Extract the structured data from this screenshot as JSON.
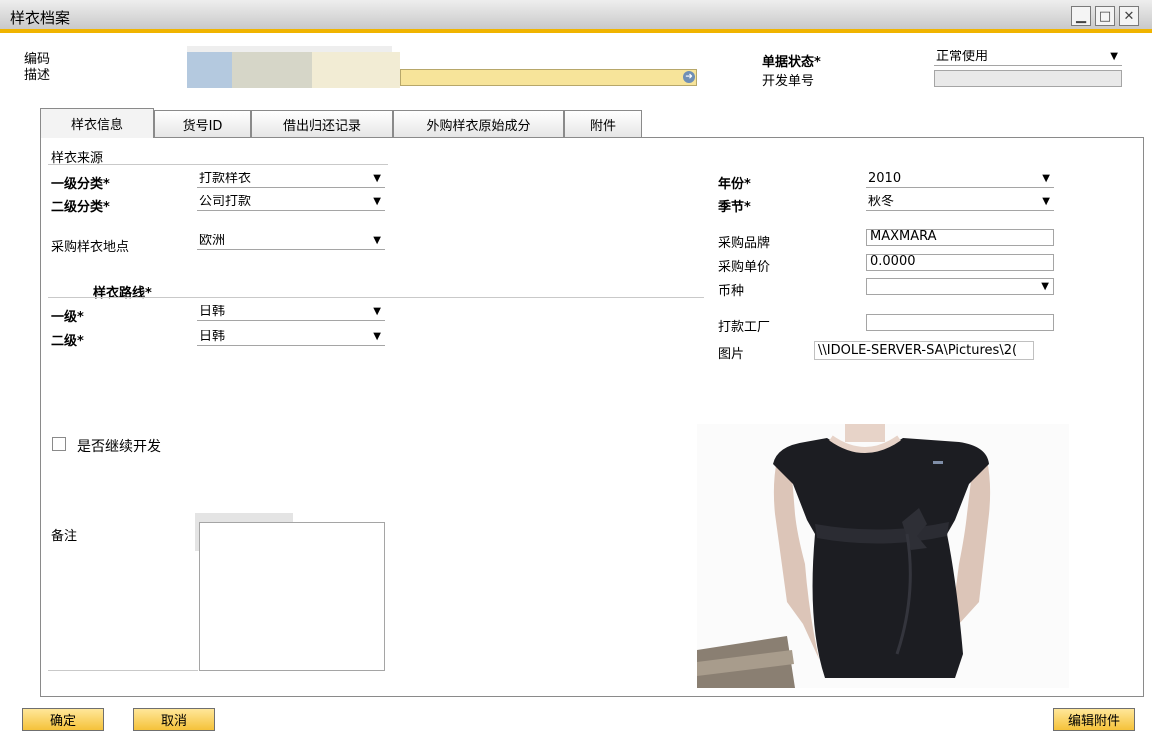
{
  "window": {
    "title": "样衣档案",
    "controls": [
      "minimize-icon",
      "maximize-icon",
      "close-icon"
    ]
  },
  "header": {
    "code_label": "编码",
    "desc_label": "描述",
    "doc_status_label": "单据状态*",
    "doc_status_value": "正常使用",
    "dev_no_label": "开发单号"
  },
  "tabs": [
    {
      "label": "样衣信息",
      "active": true
    },
    {
      "label": "货号ID"
    },
    {
      "label": "借出归还记录"
    },
    {
      "label": "外购样衣原始成分"
    },
    {
      "label": "附件"
    }
  ],
  "form": {
    "source_label": "样衣来源",
    "cat1_label": "一级分类*",
    "cat1_value": "打款样衣",
    "cat2_label": "二级分类*",
    "cat2_value": "公司打款",
    "purchase_place_label": "采购样衣地点",
    "purchase_place_value": "欧洲",
    "route_label": "样衣路线*",
    "route1_label": "一级*",
    "route1_value": "日韩",
    "route2_label": "二级*",
    "route2_value": "日韩",
    "continue_dev_label": "是否继续开发",
    "remark_label": "备注",
    "year_label": "年份*",
    "year_value": "2010",
    "season_label": "季节*",
    "season_value": "秋冬",
    "brand_label": "采购品牌",
    "brand_value": "MAXMARA",
    "price_label": "采购单价",
    "price_value": "0.0000",
    "currency_label": "币种",
    "currency_value": "",
    "factory_label": "打款工厂",
    "factory_value": "",
    "picture_label": "图片",
    "picture_value": "\\\\IDOLE-SERVER-SA\\Pictures\\2("
  },
  "footer": {
    "ok_label": "确定",
    "cancel_label": "取消",
    "edit_attach_label": "编辑附件"
  },
  "colors": {
    "accent": "#f0b400",
    "button": "#f5c23a",
    "desc_field": "#f7e49a"
  }
}
